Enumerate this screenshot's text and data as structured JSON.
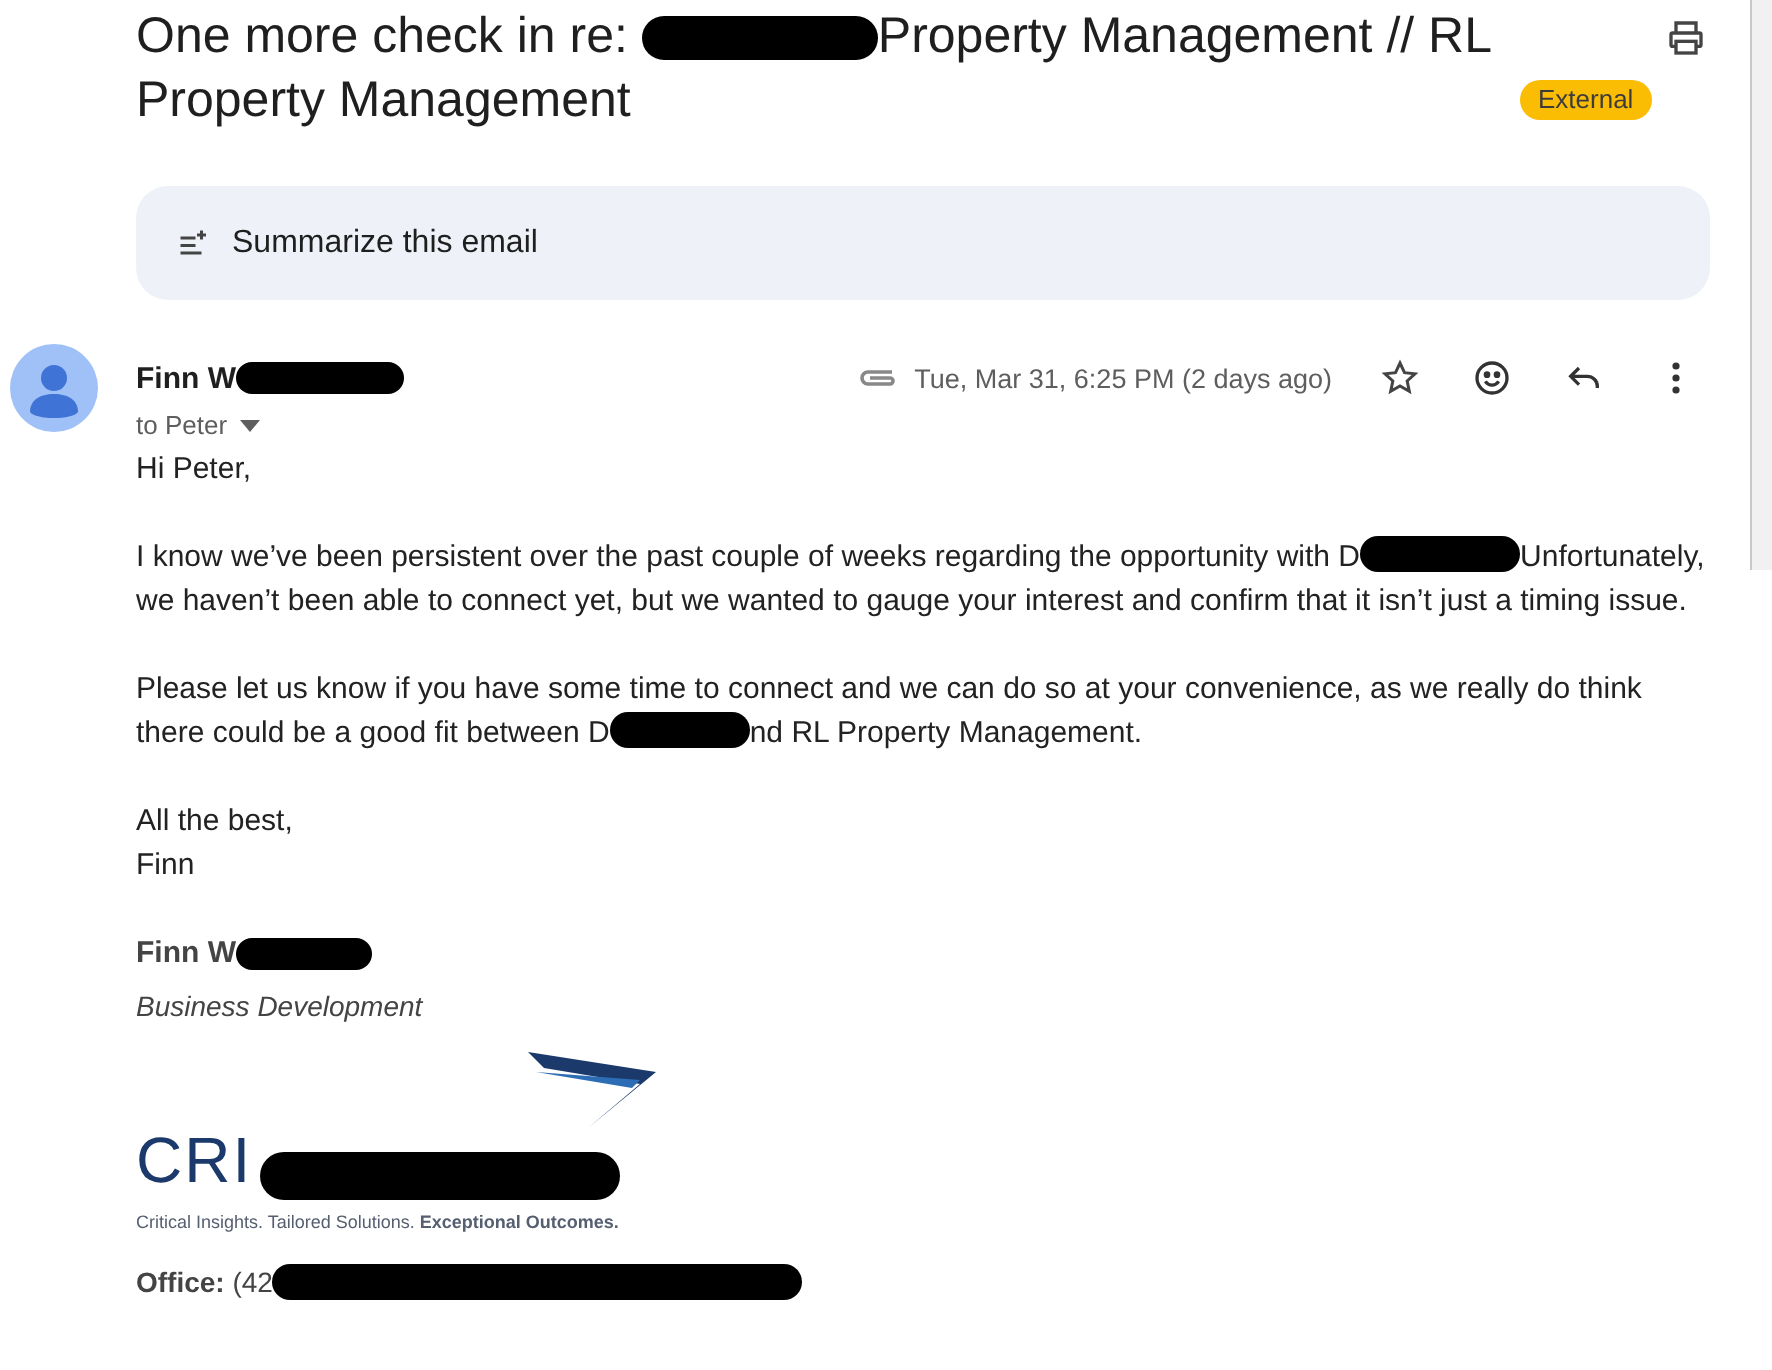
{
  "subject": {
    "parts": [
      {
        "kind": "text",
        "text": "One more check in re: "
      },
      {
        "kind": "redaction"
      },
      {
        "kind": "text",
        "text": "Property Management // RL Property Management"
      }
    ],
    "badge": "External"
  },
  "summarize": {
    "label": "Summarize this email"
  },
  "message": {
    "sender": [
      {
        "kind": "text",
        "text": "Finn W"
      },
      {
        "kind": "redaction"
      }
    ],
    "recipient": "to Peter",
    "date": "Tue, Mar 31, 6:25 PM (2 days ago)",
    "has_attachment": true,
    "starred": false
  },
  "body": [
    {
      "parts": [
        {
          "kind": "text",
          "text": "Hi Peter,"
        }
      ]
    },
    {
      "parts": [
        {
          "kind": "text",
          "text": "I know we’ve been persistent over the past couple of weeks regarding the opportunity with D"
        },
        {
          "kind": "redaction"
        },
        {
          "kind": "text",
          "text": "Unfortunately, we haven’t been able to connect yet, but we wanted to gauge your interest and confirm that it isn’t just a timing issue."
        }
      ]
    },
    {
      "parts": [
        {
          "kind": "text",
          "text": "Please let us know if you have some time to connect and we can do so at your convenience, as we really do think there could be a good fit between D"
        },
        {
          "kind": "redaction"
        },
        {
          "kind": "text",
          "text": "nd RL Property Management."
        }
      ]
    },
    {
      "parts": [
        {
          "kind": "text",
          "text": "All the best,"
        }
      ]
    },
    {
      "parts": [
        {
          "kind": "text",
          "text": "Finn"
        }
      ]
    }
  ],
  "signature": {
    "name": [
      {
        "kind": "text",
        "text": "Finn W"
      },
      {
        "kind": "redaction"
      }
    ],
    "title": "Business Development",
    "logo_text": [
      {
        "kind": "text",
        "text": "CRI"
      },
      {
        "kind": "redaction"
      }
    ],
    "tagline": "Critical Insights. Tailored Solutions. **Exceptional Outcomes.**",
    "office": [
      {
        "kind": "text",
        "text": "**Office:** (42"
      },
      {
        "kind": "redaction"
      }
    ]
  }
}
